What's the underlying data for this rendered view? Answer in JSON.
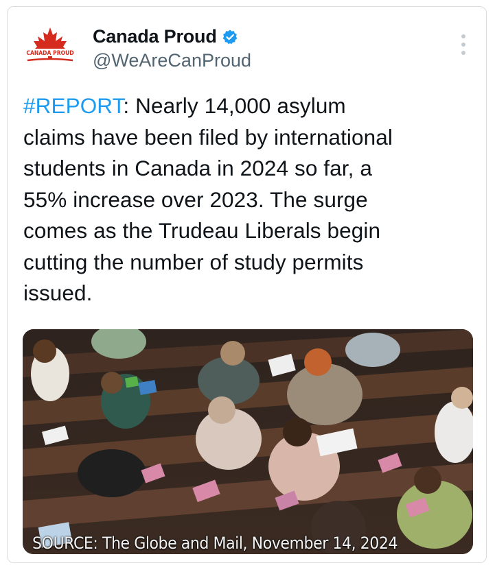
{
  "account": {
    "display_name": "Canada Proud",
    "handle": "@WeAreCanProud",
    "avatar_label": "CANADA PROUD",
    "verified": true
  },
  "tweet": {
    "hashtag": "#REPORT",
    "body_lines": [
      ": Nearly 14,000 asylum",
      "claims have been filed by international",
      "students in Canada in 2024 so far, a",
      "55% increase over 2023. The surge",
      "comes as the Trudeau Liberals begin",
      "cutting the number of study permits",
      "issued."
    ]
  },
  "media": {
    "caption": "SOURCE: The Globe and Mail, November 14, 2024",
    "alt_subject": "students-in-lecture-hall-photo"
  },
  "colors": {
    "hashtag": "#1d9bf0",
    "verified_badge": "#1d9bf0",
    "maple_red": "#d52b1e",
    "text": "#0f1419",
    "handle": "#536471"
  }
}
